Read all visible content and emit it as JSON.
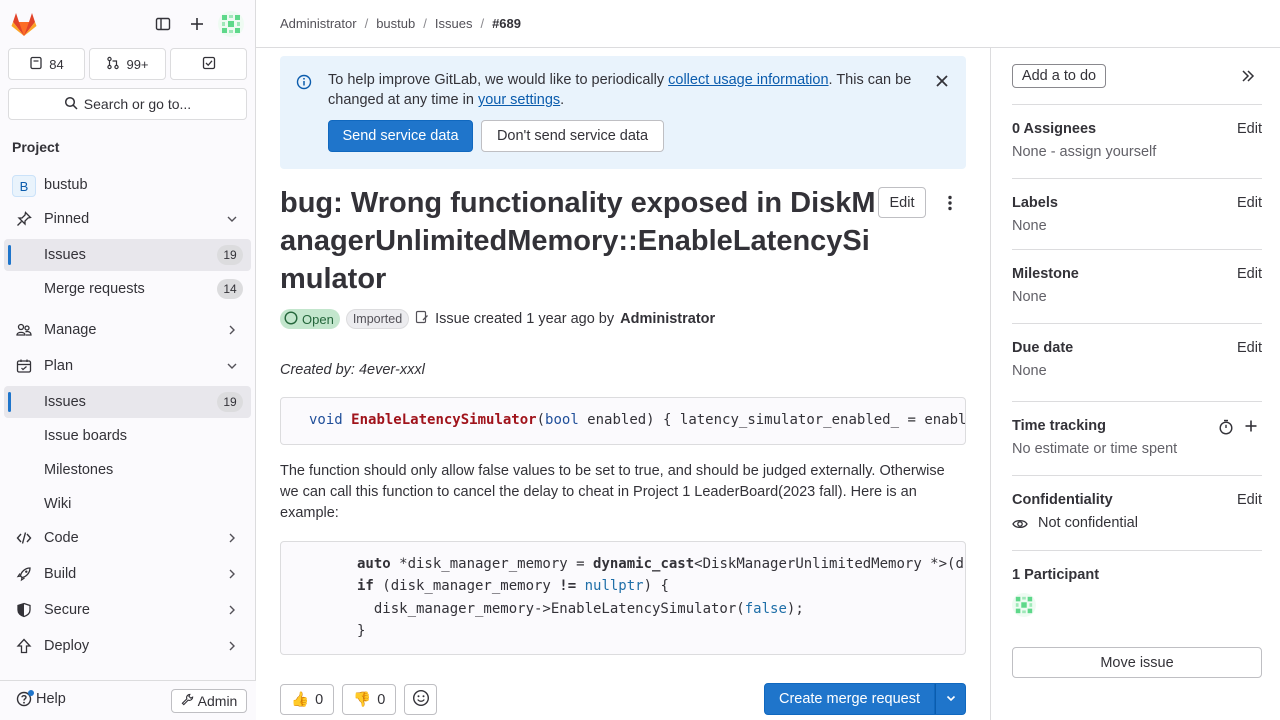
{
  "sidebar": {
    "counters": [
      {
        "icon": "issues-icon",
        "value": "84"
      },
      {
        "icon": "merge-request-icon",
        "value": "99+"
      },
      {
        "icon": "todo-icon",
        "value": ""
      }
    ],
    "search_label": "Search or go to...",
    "section_title": "Project",
    "project_initial": "B",
    "project_name": "bustub",
    "pinned_label": "Pinned",
    "pinned_items": [
      {
        "label": "Issues",
        "count": "19"
      },
      {
        "label": "Merge requests",
        "count": "14"
      }
    ],
    "manage_label": "Manage",
    "plan_label": "Plan",
    "plan_items": [
      {
        "label": "Issues",
        "count": "19"
      },
      {
        "label": "Issue boards"
      },
      {
        "label": "Milestones"
      },
      {
        "label": "Wiki"
      }
    ],
    "code_label": "Code",
    "build_label": "Build",
    "secure_label": "Secure",
    "deploy_label": "Deploy",
    "help_label": "Help",
    "admin_label": "Admin"
  },
  "breadcrumb": [
    "Administrator",
    "bustub",
    "Issues",
    "#689"
  ],
  "alert": {
    "text_before": "To help improve GitLab, we would like to periodically ",
    "link1": "collect usage information",
    "text_middle": ". This can be changed at any time in ",
    "link2": "your settings",
    "text_after": ".",
    "send_label": "Send service data",
    "dont_send_label": "Don't send service data"
  },
  "issue": {
    "title": "bug: Wrong functionality exposed in DiskManagerUnlimitedMemory::EnableLatencySimulator",
    "edit_label": "Edit",
    "status": "Open",
    "imported": "Imported",
    "created_text": "Issue created 1 year ago by",
    "author": "Administrator",
    "created_by": "Created by: 4ever-xxxl",
    "description": "The function should only allow false values to be set to true, and should be judged externally. Otherwise we can call this function to cancel the delay to cheat in Project 1 LeaderBoard(2023 fall). Here is an example:",
    "code1": {
      "t1": "void",
      "t2": "EnableLatencySimulator",
      "t3": "(",
      "t4": "bool",
      "t5": " enabled) { latency_simulator_enabled_ = enabled; }"
    },
    "code2": {
      "l1a": "auto",
      "l1b": " *disk_manager_memory = ",
      "l1c": "dynamic_cast",
      "l1d": "<DiskManagerUnlimitedMemory *>(disk_manager);",
      "l2a": "if",
      "l2b": " (disk_manager_memory ",
      "l2c": "!=",
      "l2d": " ",
      "l2e": "nullptr",
      "l2f": ") {",
      "l3a": "  disk_manager_memory->EnableLatencySimulator(",
      "l3b": "false",
      "l3c": ");",
      "l4": "}"
    },
    "thumbs_up": "0",
    "thumbs_down": "0",
    "create_mr_label": "Create merge request"
  },
  "right_sidebar": {
    "todo_label": "Add a to do",
    "assignees": {
      "title": "0 Assignees",
      "edit": "Edit",
      "value": "None - assign yourself"
    },
    "labels": {
      "title": "Labels",
      "edit": "Edit",
      "value": "None"
    },
    "milestone": {
      "title": "Milestone",
      "edit": "Edit",
      "value": "None"
    },
    "due_date": {
      "title": "Due date",
      "edit": "Edit",
      "value": "None"
    },
    "time_tracking": {
      "title": "Time tracking",
      "value": "No estimate or time spent"
    },
    "confidentiality": {
      "title": "Confidentiality",
      "edit": "Edit",
      "value": "Not confidential"
    },
    "participants": {
      "title": "1 Participant"
    },
    "move_label": "Move issue"
  },
  "colors": {
    "accent": "#1f75cb",
    "open_status": "#c3e6cd",
    "alert_bg": "#e9f3fc"
  }
}
